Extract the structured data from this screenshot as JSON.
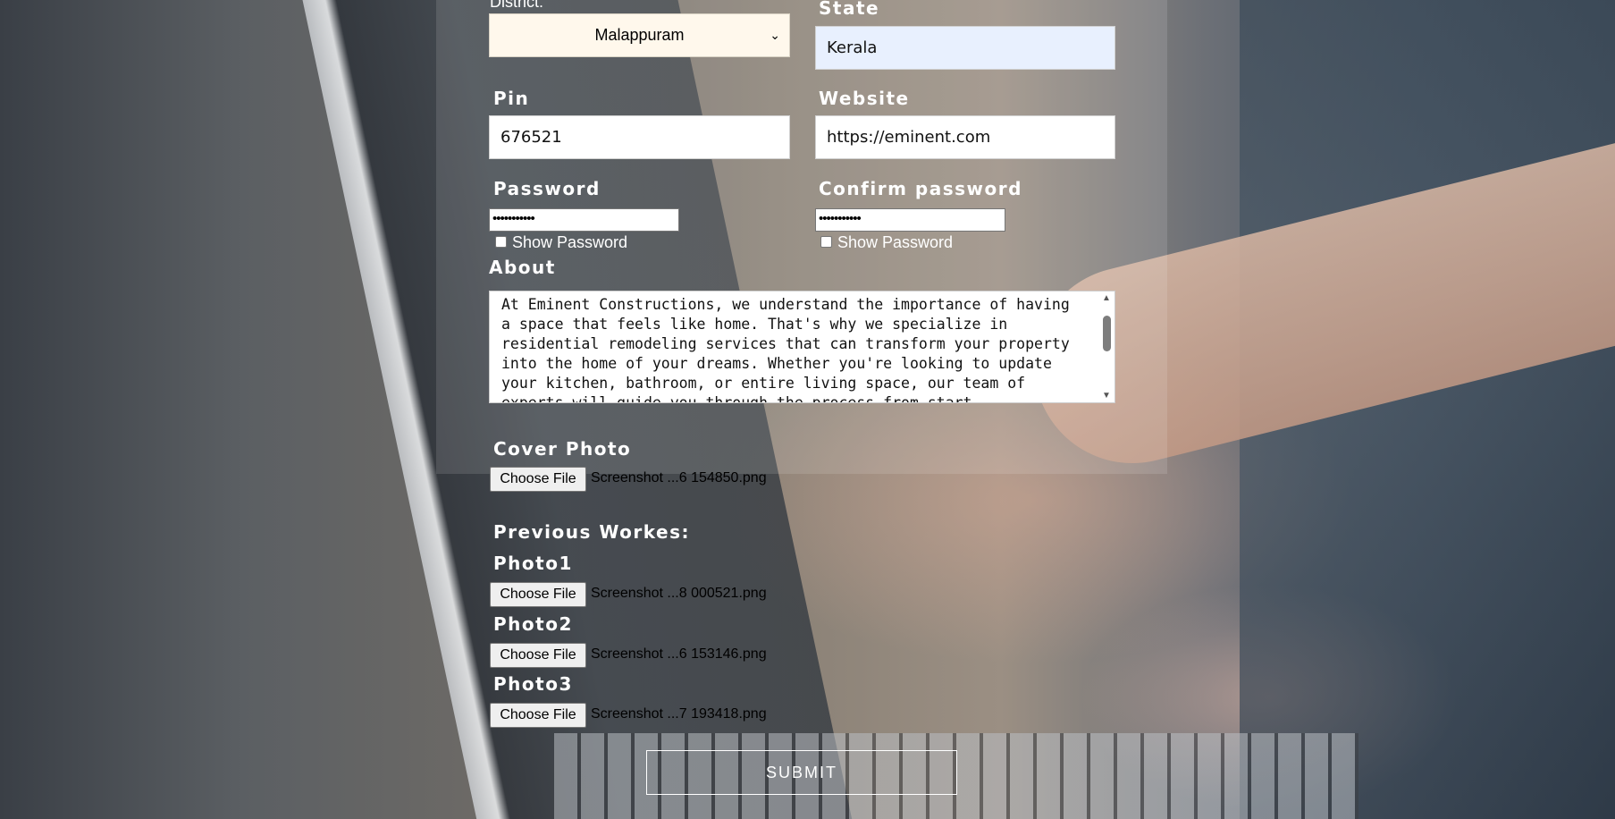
{
  "form": {
    "district": {
      "label": "District:",
      "value": "Malappuram"
    },
    "state": {
      "label": "State",
      "value": "Kerala"
    },
    "pin": {
      "label": "Pin",
      "value": "676521"
    },
    "website": {
      "label": "Website",
      "value": "https://eminent.com"
    },
    "password": {
      "label": "Password",
      "value": "•••••••••••",
      "show_label": "Show Password"
    },
    "confirm_password": {
      "label": "Confirm password",
      "value": "•••••••••••",
      "show_label": "Show Password"
    },
    "about": {
      "label": "About",
      "value": "At Eminent Constructions, we understand the importance of having a space that feels like home. That's why we specialize in residential remodeling services that can transform your property into the home of your dreams. Whether you're looking to update your kitchen, bathroom, or entire living space, our team of experts will guide you through the process from start"
    },
    "cover_photo": {
      "label": "Cover Photo",
      "button": "Choose File",
      "filename": "Screenshot ...6 154850.png"
    },
    "previous_works": {
      "label": "Previous Workes:",
      "photos": [
        {
          "label": "Photo1",
          "button": "Choose File",
          "filename": "Screenshot ...8 000521.png"
        },
        {
          "label": "Photo2",
          "button": "Choose File",
          "filename": "Screenshot ...6 153146.png"
        },
        {
          "label": "Photo3",
          "button": "Choose File",
          "filename": "Screenshot ...7 193418.png"
        }
      ]
    },
    "submit_label": "SUBMIT"
  },
  "icons": {
    "select_chevron": "chevron-down-icon",
    "scroll_up": "scroll-up-arrow-icon",
    "scroll_down": "scroll-down-arrow-icon"
  },
  "colors": {
    "select_bg": "#fff8ec",
    "autofill_bg": "#e8f0fe",
    "label_text": "#ffffff"
  }
}
